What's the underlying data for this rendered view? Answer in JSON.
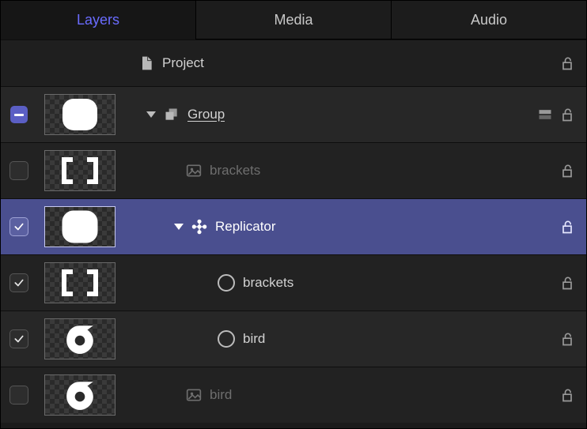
{
  "tabs": {
    "layers": "Layers",
    "media": "Media",
    "audio": "Audio",
    "active": "layers"
  },
  "rows": {
    "project": {
      "label": "Project"
    },
    "group": {
      "label": "Group"
    },
    "bracketsA": {
      "label": "brackets"
    },
    "replicator": {
      "label": "Replicator"
    },
    "bracketsB": {
      "label": "brackets"
    },
    "birdA": {
      "label": "bird"
    },
    "birdB": {
      "label": "bird"
    }
  },
  "state": {
    "group_enabled": "mixed",
    "bracketsA_enabled": false,
    "replicator_enabled": true,
    "bracketsB_enabled": true,
    "birdA_enabled": true,
    "birdB_enabled": false,
    "selected_row": "replicator",
    "group_expanded": true,
    "replicator_expanded": true
  },
  "icons": {
    "project": "document-icon",
    "group": "group-stack-icon",
    "image": "image-icon",
    "replicator": "replicator-icon",
    "cell": "circle-icon",
    "lock": "lock-open-icon",
    "isolate": "isolate-group-icon"
  },
  "colors": {
    "accent": "#6a6cff",
    "selection": "#4a4f8f"
  }
}
